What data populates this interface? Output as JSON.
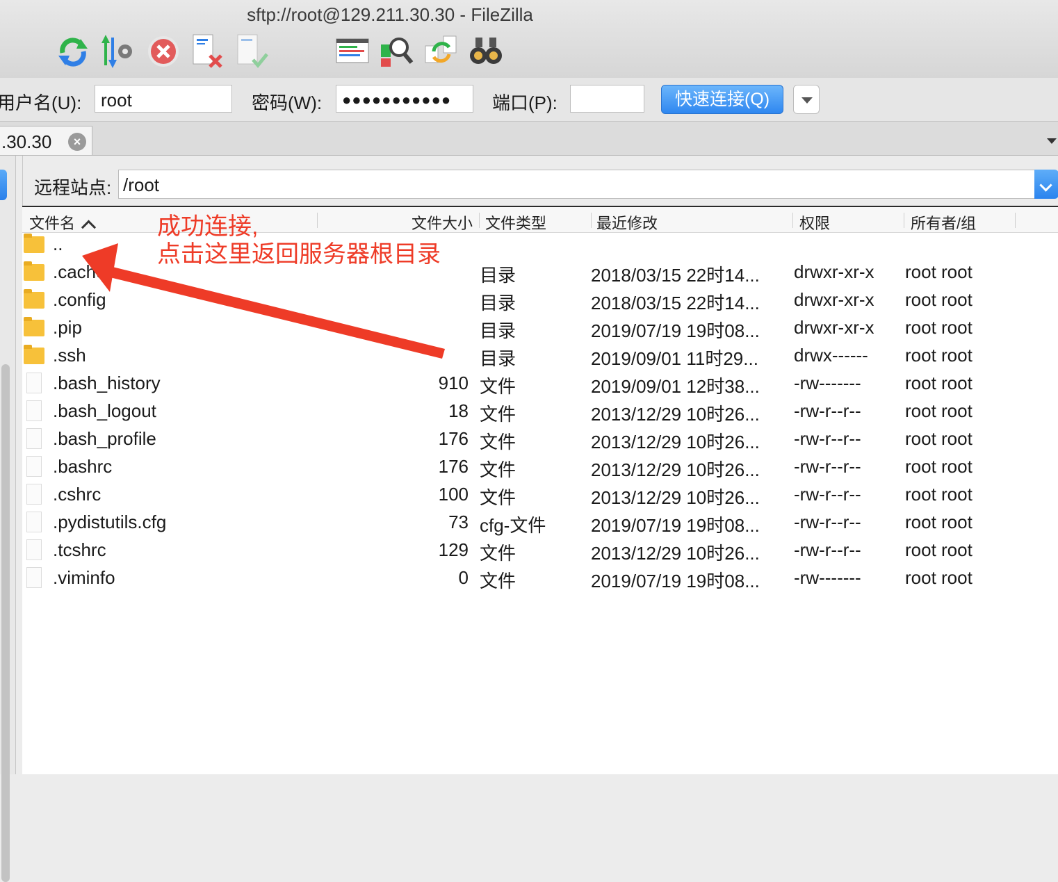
{
  "window": {
    "title": "sftp://root@129.211.30.30 - FileZilla"
  },
  "toolbar": {
    "icons": [
      "refresh-icon",
      "process-queue-icon",
      "cancel-icon",
      "disconnect-icon",
      "reconnect-icon",
      "toggle-log-icon",
      "search-remote-icon",
      "sync-browse-icon",
      "binoculars-icon"
    ],
    "colors": {
      "green": "#2fb34a",
      "blue": "#2f7fe6",
      "red": "#e24b4b"
    }
  },
  "quickconnect": {
    "user_label": "用户名(U):",
    "user_value": "root",
    "pass_label": "密码(W):",
    "pass_value": "●●●●●●●●●●●",
    "port_label": "端口(P):",
    "port_value": "",
    "button_label": "快速连接(Q)"
  },
  "tab": {
    "label": ".30.30",
    "close_glyph": "×"
  },
  "remote": {
    "site_label": "远程站点:",
    "site_path": "/root",
    "columns": {
      "name": "文件名",
      "size": "文件大小",
      "type": "文件类型",
      "modified": "最近修改",
      "perms": "权限",
      "owner": "所有者/组"
    },
    "files": [
      {
        "icon": "folder",
        "name": "..",
        "size": "",
        "type": "",
        "modified": "",
        "perms": "",
        "owner": ""
      },
      {
        "icon": "folder",
        "name": ".cache",
        "size": "",
        "type": "目录",
        "modified": "2018/03/15 22时14...",
        "perms": "drwxr-xr-x",
        "owner": "root root"
      },
      {
        "icon": "folder",
        "name": ".config",
        "size": "",
        "type": "目录",
        "modified": "2018/03/15 22时14...",
        "perms": "drwxr-xr-x",
        "owner": "root root"
      },
      {
        "icon": "folder",
        "name": ".pip",
        "size": "",
        "type": "目录",
        "modified": "2019/07/19 19时08...",
        "perms": "drwxr-xr-x",
        "owner": "root root"
      },
      {
        "icon": "folder",
        "name": ".ssh",
        "size": "",
        "type": "目录",
        "modified": "2019/09/01 11时29...",
        "perms": "drwx------",
        "owner": "root root"
      },
      {
        "icon": "file",
        "name": ".bash_history",
        "size": "910",
        "type": "文件",
        "modified": "2019/09/01 12时38...",
        "perms": "-rw-------",
        "owner": "root root"
      },
      {
        "icon": "file",
        "name": ".bash_logout",
        "size": "18",
        "type": "文件",
        "modified": "2013/12/29 10时26...",
        "perms": "-rw-r--r--",
        "owner": "root root"
      },
      {
        "icon": "file",
        "name": ".bash_profile",
        "size": "176",
        "type": "文件",
        "modified": "2013/12/29 10时26...",
        "perms": "-rw-r--r--",
        "owner": "root root"
      },
      {
        "icon": "file",
        "name": ".bashrc",
        "size": "176",
        "type": "文件",
        "modified": "2013/12/29 10时26...",
        "perms": "-rw-r--r--",
        "owner": "root root"
      },
      {
        "icon": "file",
        "name": ".cshrc",
        "size": "100",
        "type": "文件",
        "modified": "2013/12/29 10时26...",
        "perms": "-rw-r--r--",
        "owner": "root root"
      },
      {
        "icon": "file",
        "name": ".pydistutils.cfg",
        "size": "73",
        "type": "cfg-文件",
        "modified": "2019/07/19 19时08...",
        "perms": "-rw-r--r--",
        "owner": "root root"
      },
      {
        "icon": "file",
        "name": ".tcshrc",
        "size": "129",
        "type": "文件",
        "modified": "2013/12/29 10时26...",
        "perms": "-rw-r--r--",
        "owner": "root root"
      },
      {
        "icon": "file",
        "name": ".viminfo",
        "size": "0",
        "type": "文件",
        "modified": "2019/07/19 19时08...",
        "perms": "-rw-------",
        "owner": "root root"
      }
    ]
  },
  "annotation": {
    "line1": "成功连接,",
    "line2": "点击这里返回服务器根目录",
    "color": "#ee3b27"
  }
}
